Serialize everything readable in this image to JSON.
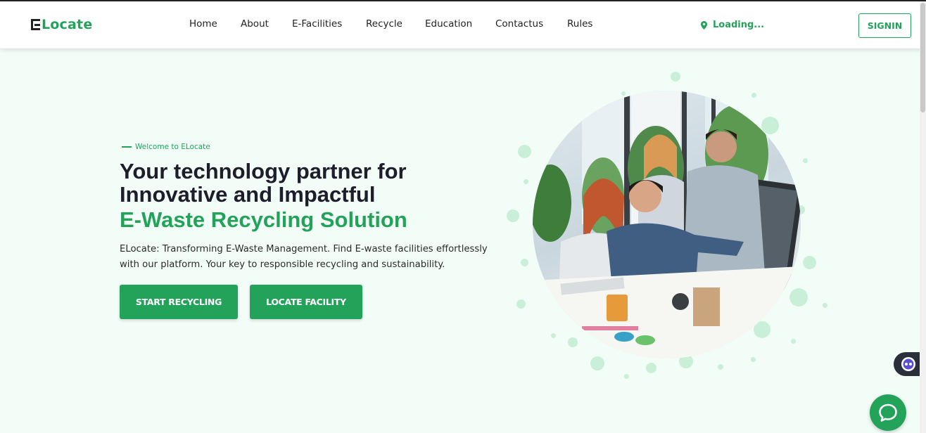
{
  "brand": {
    "name": "Locate"
  },
  "nav": {
    "items": [
      {
        "label": "Home"
      },
      {
        "label": "About"
      },
      {
        "label": "E-Facilities"
      },
      {
        "label": "Recycle"
      },
      {
        "label": "Education"
      },
      {
        "label": "Contactus"
      },
      {
        "label": "Rules"
      }
    ]
  },
  "location": {
    "text": "Loading...",
    "icon": "map-pin-icon"
  },
  "auth": {
    "signin_label": "SIGNIN"
  },
  "hero": {
    "tagline": "Welcome to ELocate",
    "headline_line1": "Your technology partner for",
    "headline_line2": "Innovative and Impactful",
    "headline_highlight": "E-Waste Recycling Solution",
    "description": "ELocate: Transforming E-Waste Management. Find E-waste facilities effortlessly with our platform. Your key to responsible recycling and sustainability.",
    "primary_button": "START RECYCLING",
    "secondary_button": "LOCATE FACILITY"
  },
  "widgets": {
    "bot_icon": "chatbot-icon",
    "chat_icon": "chat-bubble-icon"
  },
  "colors": {
    "accent": "#23a35a",
    "background": "#f3fdf8",
    "heading": "#1d1d2b",
    "dots": "#c9efd8"
  }
}
